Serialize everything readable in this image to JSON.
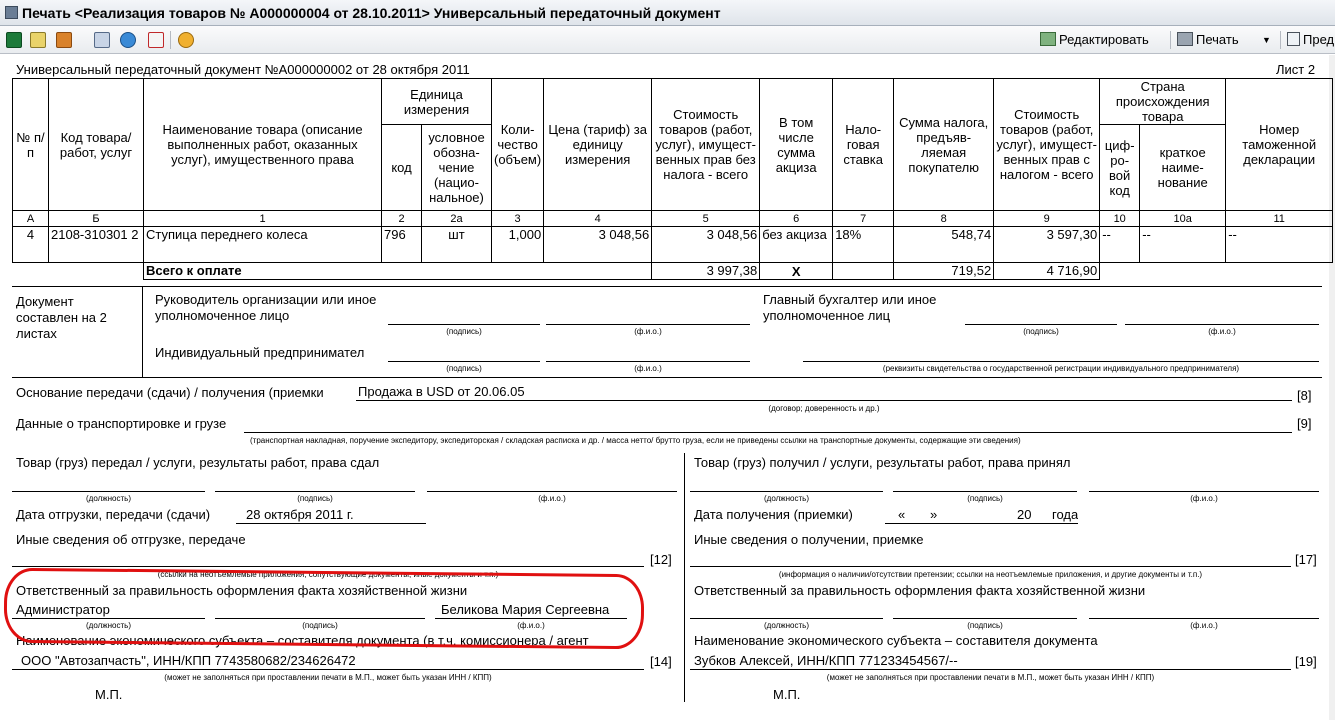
{
  "window": {
    "title": "Печать <Реализация товаров № А000000004 от 28.10.2011> Универсальный передаточный документ"
  },
  "toolbar": {
    "icons": [
      "excel-icon",
      "chart-icon",
      "export-icon",
      "copy-icon",
      "browser-icon",
      "pdf-icon",
      "help-icon"
    ],
    "edit_label": "Редактировать",
    "print_label": "Печать",
    "preview_label": "Пред"
  },
  "doc": {
    "header_title": "Универсальный передаточный документ №А000000002 от 28 октября 2011",
    "sheet": "Лист 2",
    "columns": {
      "num": "№ п/п",
      "code": "Код товара/ работ, услуг",
      "name": "Наименование товара (описание выполненных работ, оказанных услуг), имущественного права",
      "unit_group": "Единица измерения",
      "unit_code": "код",
      "unit_name": "условное обозна-чение (нацио-нальное)",
      "qty": "Коли-чество (объем)",
      "price": "Цена (тариф) за единицу измерения",
      "cost_no_tax": "Стоимость товаров (работ, услуг), имущест-венных прав без налога - всего",
      "excise": "В том числе сумма акциза",
      "tax_rate": "Нало-говая ставка",
      "tax_sum": "Сумма налога, предъяв-ляемая покупателю",
      "cost_with_tax": "Стоимость товаров (работ, услуг), имущест-венных прав с налогом - всего",
      "country_group": "Страна происхождения товара",
      "country_code": "циф-ро-вой код",
      "country_name": "краткое наиме-нование",
      "customs": "Номер таможенной декларации"
    },
    "col_numbers": [
      "А",
      "Б",
      "1",
      "2",
      "2а",
      "3",
      "4",
      "5",
      "6",
      "7",
      "8",
      "9",
      "10",
      "10а",
      "11"
    ],
    "rows": [
      {
        "num": "4",
        "code": "2108-310301 2",
        "name": "Ступица переднего колеса",
        "unit_code": "796",
        "unit": "шт",
        "qty": "1,000",
        "price": "3 048,56",
        "cost": "3 048,56",
        "excise": "без акциза",
        "rate": "18%",
        "tax": "548,74",
        "total": "3 597,30",
        "country_code": "--",
        "country_name": "--",
        "customs": "--"
      }
    ],
    "total": {
      "label": "Всего к оплате",
      "cost": "3 997,38",
      "excise": "X",
      "tax": "719,52",
      "sum": "4 716,90"
    },
    "composed": "Документ составлен на 2 листах",
    "head_label": "Руководитель организации или иное уполномоченное лицо",
    "chief_acc_label": "Главный бухгалтер или иное уполномоченное лиц",
    "ip_label": "Индивидуальный предпринимател",
    "cap_sign": "(подпись)",
    "cap_fio": "(ф.и.о.)",
    "cap_ip_req": "(реквизиты свидетельства о государственной регистрации индивидуального предпринимателя)",
    "basis_label": "Основание передачи (сдачи) / получения (приемки",
    "basis_value": "Продажа в USD от 20.06.05",
    "basis_num": "[8]",
    "cap_contract": "(договор; доверенность и др.)",
    "transport_label": "Данные о транспортировке и грузе",
    "transport_num": "[9]",
    "cap_transport": "(транспортная накладная, поручение экспедитору, экспедиторская / складская расписка и др. / масса нетто/ брутто груза, если не приведены ссылки на транспортные документы, содержащие эти сведения)",
    "left": {
      "handed": "Товар (груз) передал / услуги, результаты работ, права сдал",
      "cap_position": "(должность)",
      "date_label": "Дата отгрузки, передачи (сдачи)",
      "date_value": "28 октября 2011 г.",
      "other_label": "Иные сведения об отгрузке, передаче",
      "other_num": "[12]",
      "cap_other": "(ссылки на неотъемлемые приложения, сопутствующие документы, иные документы и т.п.)",
      "responsible": "Ответственный за правильность оформления факта хозяйственной жизни",
      "resp_position": "Администратор",
      "resp_fio": "Беликова Мария Сергеевна",
      "entity_label": "Наименование экономического субъекта – составителя документа (в т.ч. комиссионера / агент",
      "entity_value": "ООО \"Автозапчасть\", ИНН/КПП 7743580682/234626472",
      "entity_num": "[14]",
      "cap_stamp": "(может не заполняться при проставлении печати в М.П., может быть указан ИНН / КПП)",
      "mp": "М.П."
    },
    "right": {
      "received": "Товар (груз) получил / услуги, результаты работ, права принял",
      "date_label": "Дата получения (приемки)",
      "date_q1": "«",
      "date_q2": "»",
      "date_year": "20",
      "date_suffix": "года",
      "other_label": "Иные сведения о получении, приемке",
      "other_num": "[17]",
      "cap_other": "(информация о наличии/отсутствии претензии; ссылки на неотъемлемые приложения, и другие  документы и т.п.)",
      "responsible": "Ответственный за правильность оформления факта хозяйственной жизни",
      "entity_label": "Наименование экономического субъекта – составителя документа",
      "entity_value": "Зубков Алексей, ИНН/КПП 771233454567/--",
      "entity_num": "[19]",
      "cap_stamp": "(может не заполняться при проставлении печати в М.П., может быть указан ИНН / КПП)",
      "mp": "М.П."
    }
  },
  "colors": {
    "annotation_ring": "#e01010"
  }
}
